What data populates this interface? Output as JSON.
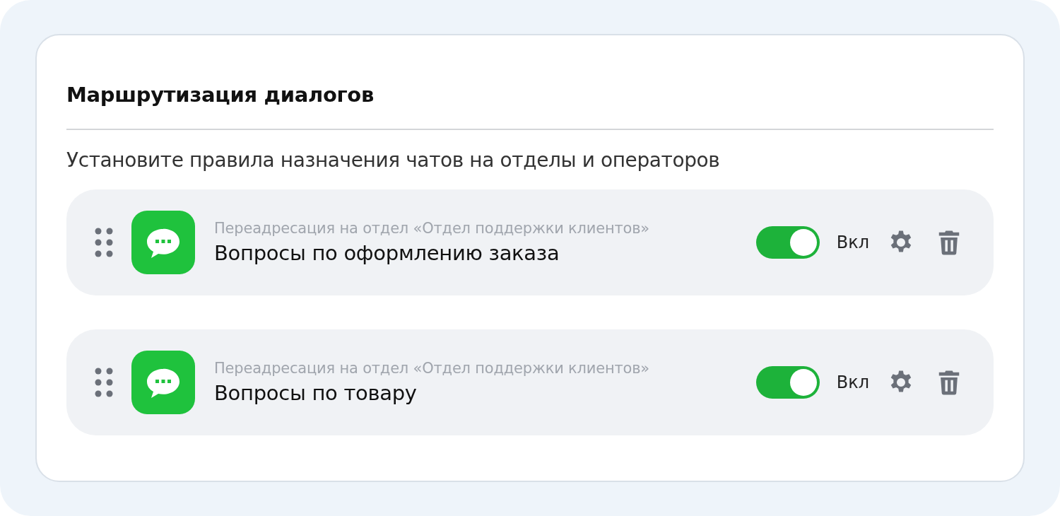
{
  "title": "Маршрутизация диалогов",
  "description": "Установите правила назначения чатов на отделы и операторов",
  "rules": [
    {
      "caption": "Переадресация на отдел «Отдел поддержки клиентов»",
      "name": "Вопросы по оформлению заказа",
      "on": true,
      "status": "Вкл"
    },
    {
      "caption": "Переадресация на отдел «Отдел поддержки клиентов»",
      "name": "Вопросы по товару",
      "on": true,
      "status": "Вкл"
    }
  ]
}
